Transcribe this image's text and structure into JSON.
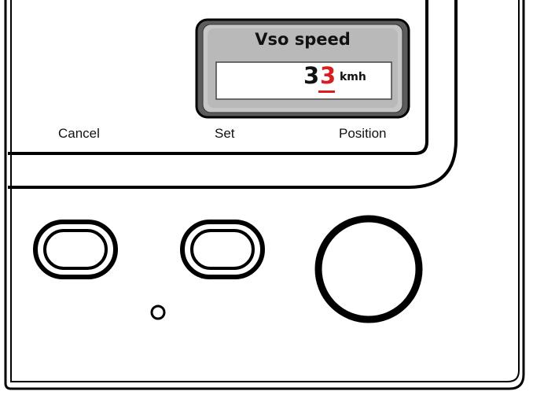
{
  "display": {
    "title": "Vso speed",
    "value_fixed_digit": "3",
    "value_edit_digit": "3",
    "unit": "kmh",
    "edit_color": "#d81e1e"
  },
  "softkeys": {
    "left": "Cancel",
    "middle": "Set",
    "right": "Position"
  },
  "controls": {
    "left_button": "oval-button",
    "middle_button": "oval-button",
    "knob": "rotary-knob",
    "indicator": "status-led"
  }
}
